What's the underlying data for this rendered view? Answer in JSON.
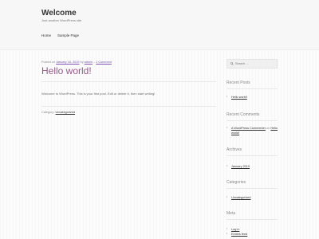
{
  "site": {
    "title": "Welcome",
    "description": "Just another WordPress site"
  },
  "nav": [
    {
      "label": "Home"
    },
    {
      "label": "Sample Page"
    }
  ],
  "post": {
    "meta": {
      "posted_on": "Posted on",
      "date": "January 16, 2019",
      "by": "by",
      "author": "admin",
      "separator": "–",
      "comments": "1 Comment"
    },
    "title": "Hello world!",
    "body": "Welcome to WordPress. This is your first post. Edit or delete it, then start writing!",
    "category_label": "Category:",
    "category": "Uncategorized"
  },
  "search": {
    "placeholder": "Search …"
  },
  "widgets": {
    "recent_posts": {
      "title": "Recent Posts",
      "items": [
        "Hello world!"
      ]
    },
    "recent_comments": {
      "title": "Recent Comments",
      "author": "A WordPress Commenter",
      "on": "on",
      "post": "Hello world!"
    },
    "archives": {
      "title": "Archives",
      "items": [
        "January 2019"
      ]
    },
    "categories": {
      "title": "Categories",
      "items": [
        "Uncategorized"
      ]
    },
    "meta": {
      "title": "Meta",
      "items": [
        "Log in",
        "Entries feed"
      ]
    }
  },
  "colors": {
    "accent": "#96588a",
    "link": "#333333",
    "text": "#6d6d6d"
  },
  "icons": {
    "search": "search-icon"
  }
}
